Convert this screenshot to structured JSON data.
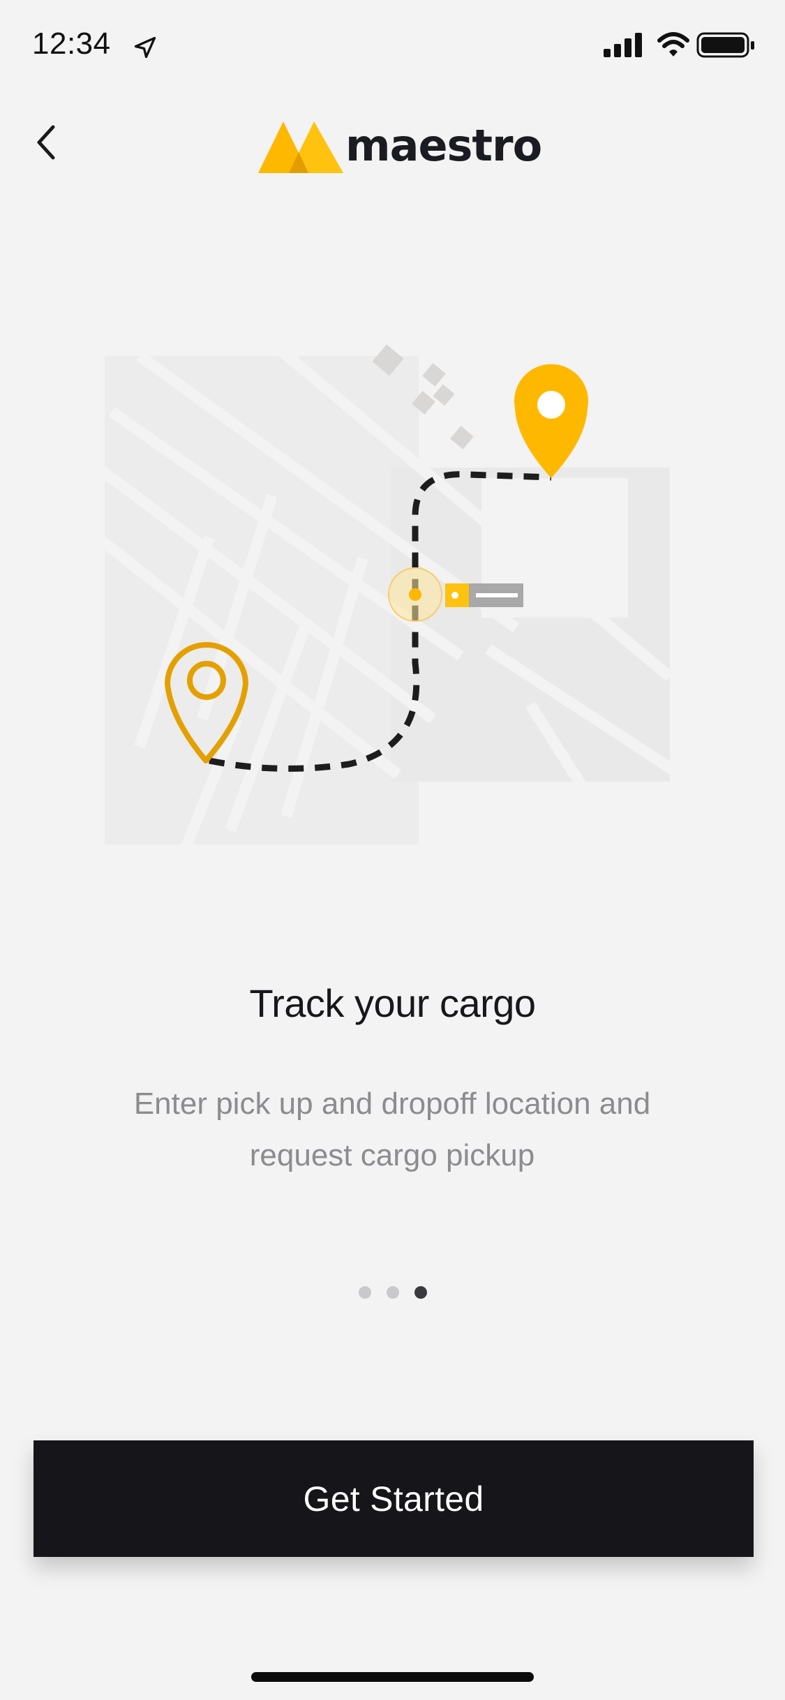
{
  "status_bar": {
    "time": "12:34",
    "icons": [
      "location-arrow-icon",
      "signal-icon",
      "wifi-icon",
      "battery-icon"
    ]
  },
  "header": {
    "back_icon": "chevron-left-icon",
    "logo_text": "maestro"
  },
  "onboarding": {
    "title": "Track your cargo",
    "subtitle": "Enter pick up and dropoff location and request cargo pickup",
    "page_count": 3,
    "active_page": 3
  },
  "cta": {
    "label": "Get Started"
  },
  "colors": {
    "background": "#f3f3f3",
    "accent": "#ffb800",
    "accent_dark": "#e0a400",
    "button_bg": "#15151a",
    "button_text": "#ffffff",
    "subtitle": "#8c8c90"
  }
}
